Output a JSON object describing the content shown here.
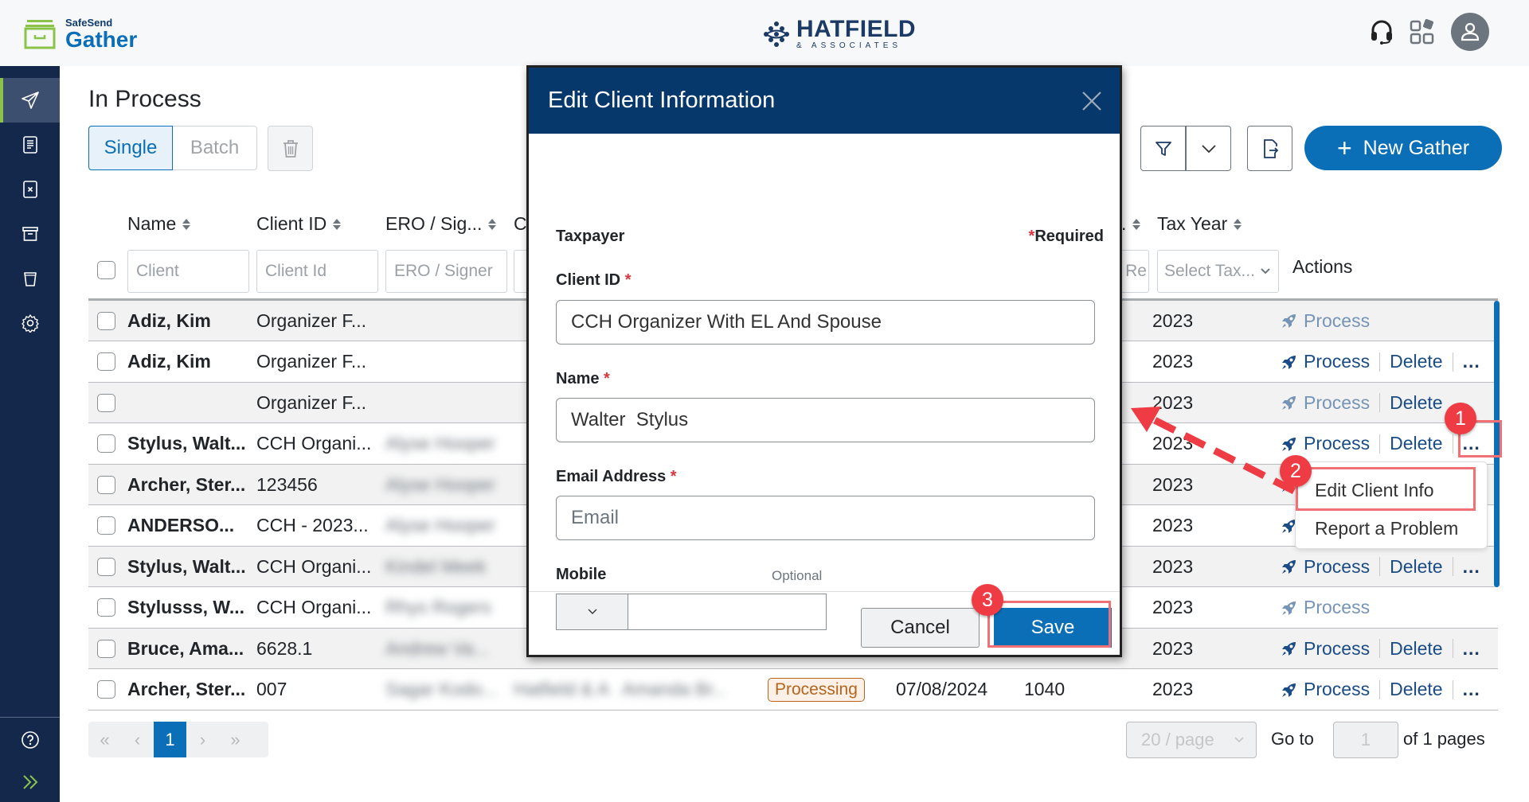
{
  "app": {
    "logo_small": "SafeSend",
    "logo_big": "Gather",
    "brand_name": "HATFIELD",
    "brand_sub": "& ASSOCIATES",
    "accent_color": "#0b6fb8",
    "sidebar_color": "#14284b"
  },
  "topbar": {
    "icons": [
      "headset-icon",
      "apps-grid-icon",
      "user-avatar-icon"
    ]
  },
  "sidebar": {
    "items": [
      {
        "icon": "send-icon",
        "active": true
      },
      {
        "icon": "document-icon",
        "active": false
      },
      {
        "icon": "cancelled-document-icon",
        "active": false
      },
      {
        "icon": "archive-icon",
        "active": false
      },
      {
        "icon": "recycle-bin-icon",
        "active": false
      },
      {
        "icon": "settings-gear-icon",
        "active": false
      }
    ],
    "bottom": [
      {
        "icon": "help-icon"
      },
      {
        "icon": "expand-chevrons-icon"
      }
    ]
  },
  "page": {
    "title": "In Process",
    "segment": {
      "single": "Single",
      "batch": "Batch",
      "selected": "Single"
    },
    "new_gather": "New Gather"
  },
  "table": {
    "headers": {
      "name": "Name",
      "client_id": "Client ID",
      "ero": "ERO / Sig...",
      "col4_partial": "C",
      "col_partial": ".",
      "tax_year": "Tax Year",
      "actions": "Actions"
    },
    "filters": {
      "client": "Client",
      "client_id": "Client Id",
      "ero": "ERO / Signer",
      "partial": "Re",
      "tax_year": "Select Tax..."
    },
    "rows": [
      {
        "name": "Adiz, Kim",
        "client_id": "Organizer F...",
        "ero": "",
        "tax_year": "2023",
        "process_enabled": false,
        "delete": false,
        "more": false
      },
      {
        "name": "Adiz, Kim",
        "client_id": "Organizer F...",
        "ero": "",
        "tax_year": "2023",
        "process_enabled": true,
        "delete": true,
        "more": true
      },
      {
        "name": "",
        "client_id": "Organizer F...",
        "ero": "",
        "tax_year": "2023",
        "process_enabled": false,
        "delete": true,
        "more": false
      },
      {
        "name": "Stylus, Walt...",
        "client_id": "CCH Organi...",
        "ero": "Alyse Hooper",
        "tax_year": "2023",
        "process_enabled": true,
        "delete": true,
        "more": true
      },
      {
        "name": "Archer, Ster...",
        "client_id": "123456",
        "ero": "Alyse Hooper",
        "tax_year": "2023",
        "process_enabled": true,
        "delete": true,
        "more": true
      },
      {
        "name": "ANDERSO...",
        "client_id": "CCH - 2023...",
        "ero": "Alyse Hooper",
        "tax_year": "2023",
        "process_enabled": true,
        "delete": true,
        "more": true
      },
      {
        "name": "Stylus, Walt...",
        "client_id": "CCH Organi...",
        "ero": "Kindel Meek",
        "tax_year": "2023",
        "process_enabled": true,
        "delete": true,
        "more": true
      },
      {
        "name": "Stylusss, W...",
        "client_id": "CCH Organi...",
        "ero": "Rhys Rogers",
        "tax_year": "2023",
        "process_enabled": false,
        "delete": false,
        "more": false
      },
      {
        "name": "Bruce, Ama...",
        "client_id": "6628.1",
        "ero": "Andrew Va...",
        "tax_year": "2023",
        "process_enabled": true,
        "delete": true,
        "more": true
      },
      {
        "name": "Archer, Ster...",
        "client_id": "007",
        "ero": "Sagar Kodo...",
        "office": "Hatfield & A...",
        "assignee": "Amanda Br...",
        "status": "Processing",
        "date": "07/08/2024",
        "form": "1040",
        "tax_year": "2023",
        "process_enabled": true,
        "delete": true,
        "more": true
      }
    ],
    "action_labels": {
      "process": "Process",
      "delete": "Delete",
      "more": "..."
    }
  },
  "context_menu": {
    "items": [
      "Edit Client Info",
      "Report a Problem"
    ]
  },
  "annotations": {
    "steps": [
      "1",
      "2",
      "3"
    ]
  },
  "pagination": {
    "current_page": "1",
    "page_size": "20 / page",
    "goto_label": "Go to",
    "goto_value": "1",
    "of_label": "of 1  pages"
  },
  "modal": {
    "title": "Edit Client Information",
    "section": "Taxpayer",
    "required_note": "Required",
    "client_id_label": "Client ID",
    "client_id_value": "CCH Organizer With EL And Spouse",
    "name_label": "Name",
    "name_value": "Walter  Stylus",
    "email_label": "Email Address",
    "email_placeholder": "Email",
    "mobile_label": "Mobile",
    "mobile_optional": "Optional",
    "mobile_value": "",
    "cancel": "Cancel",
    "save": "Save"
  }
}
